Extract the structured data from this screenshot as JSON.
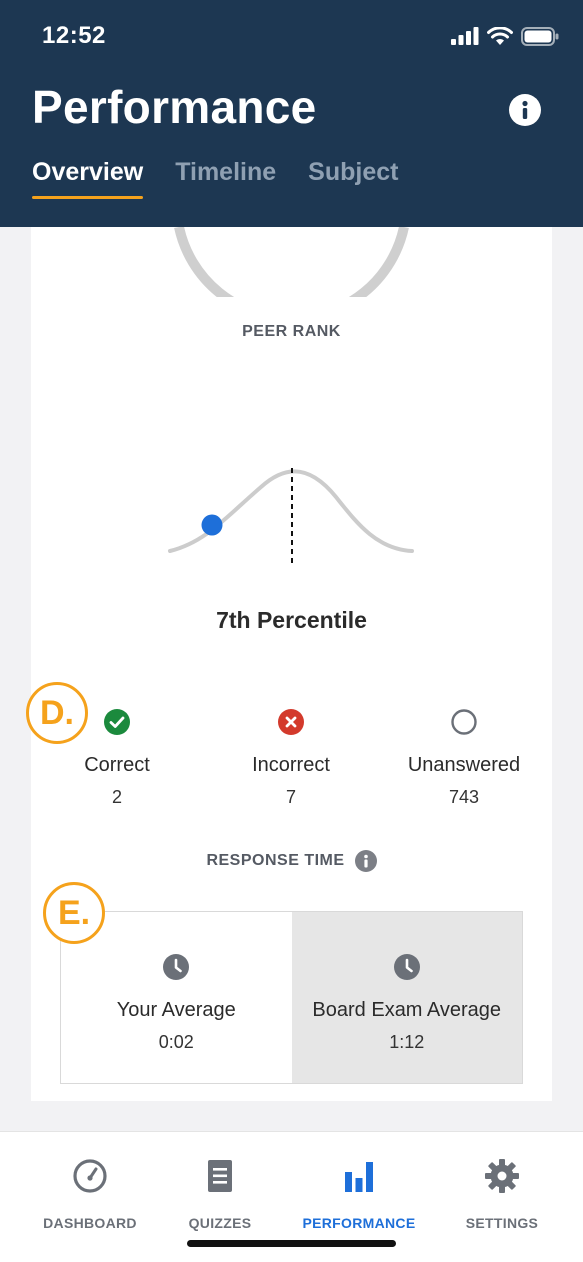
{
  "status_bar": {
    "time": "12:52"
  },
  "header": {
    "title": "Performance",
    "tabs": [
      {
        "label": "Overview",
        "active": true
      },
      {
        "label": "Timeline",
        "active": false
      },
      {
        "label": "Subject",
        "active": false
      }
    ]
  },
  "peer_rank": {
    "label": "PEER RANK",
    "percentile_text": "7th Percentile",
    "percentile": 7
  },
  "markers": {
    "d": "D.",
    "e": "E."
  },
  "stats": [
    {
      "label": "Correct",
      "value": "2",
      "icon": "check-circle-icon",
      "color": "#1b8a3d"
    },
    {
      "label": "Incorrect",
      "value": "7",
      "icon": "x-circle-icon",
      "color": "#d33a2c"
    },
    {
      "label": "Unanswered",
      "value": "743",
      "icon": "empty-circle-icon",
      "color": "#6b7078"
    }
  ],
  "response_time": {
    "label": "RESPONSE TIME",
    "your_average": {
      "label": "Your Average",
      "value": "0:02"
    },
    "board_average": {
      "label": "Board Exam Average",
      "value": "1:12"
    }
  },
  "bottom_nav": [
    {
      "label": "DASHBOARD",
      "icon": "gauge-icon",
      "active": false
    },
    {
      "label": "QUIZZES",
      "icon": "document-icon",
      "active": false
    },
    {
      "label": "PERFORMANCE",
      "icon": "bar-chart-icon",
      "active": true
    },
    {
      "label": "SETTINGS",
      "icon": "gear-icon",
      "active": false
    }
  ],
  "colors": {
    "header_bg": "#1d3752",
    "accent_orange": "#f5a21c",
    "active_blue": "#1e6fd9"
  }
}
